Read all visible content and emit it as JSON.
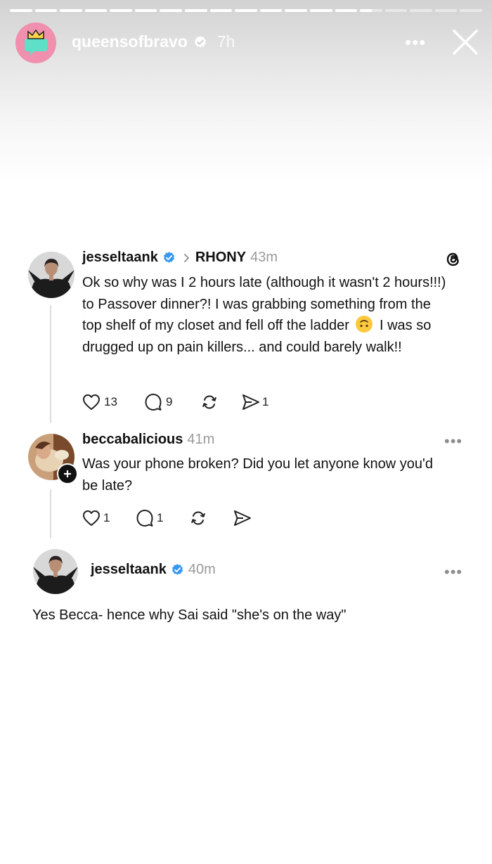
{
  "story": {
    "username": "queensofbravo",
    "time": "7h",
    "progress_segments_total": 19,
    "progress_segments_filled": 14,
    "more_label": "•••"
  },
  "thread": {
    "post": {
      "username": "jesseltaank",
      "topic": "RHONY",
      "time": "43m",
      "text_1": "Ok so why was I 2 hours late (although it wasn't 2 hours!!!) to Passover dinner?! I was grabbing something from the top shelf of my closet and fell off the ladder",
      "text_2": "I was so drugged up on pain killers... and could barely walk!!",
      "likes": "13",
      "replies": "9",
      "shares": "1"
    },
    "reply": {
      "username": "beccabalicious",
      "time": "41m",
      "text": "Was your phone broken? Did you let anyone know you'd be late?",
      "likes": "1",
      "replies": "1",
      "more_label": "•••"
    },
    "answer": {
      "username": "jesseltaank",
      "time": "40m",
      "text": "Yes Becca- hence why Sai said \"she's on the way\"",
      "more_label": "•••"
    }
  },
  "colors": {
    "verified_blue": "#3897f0",
    "story_avatar_bg": "#f08fae",
    "muted_text": "#9a9a9a"
  }
}
